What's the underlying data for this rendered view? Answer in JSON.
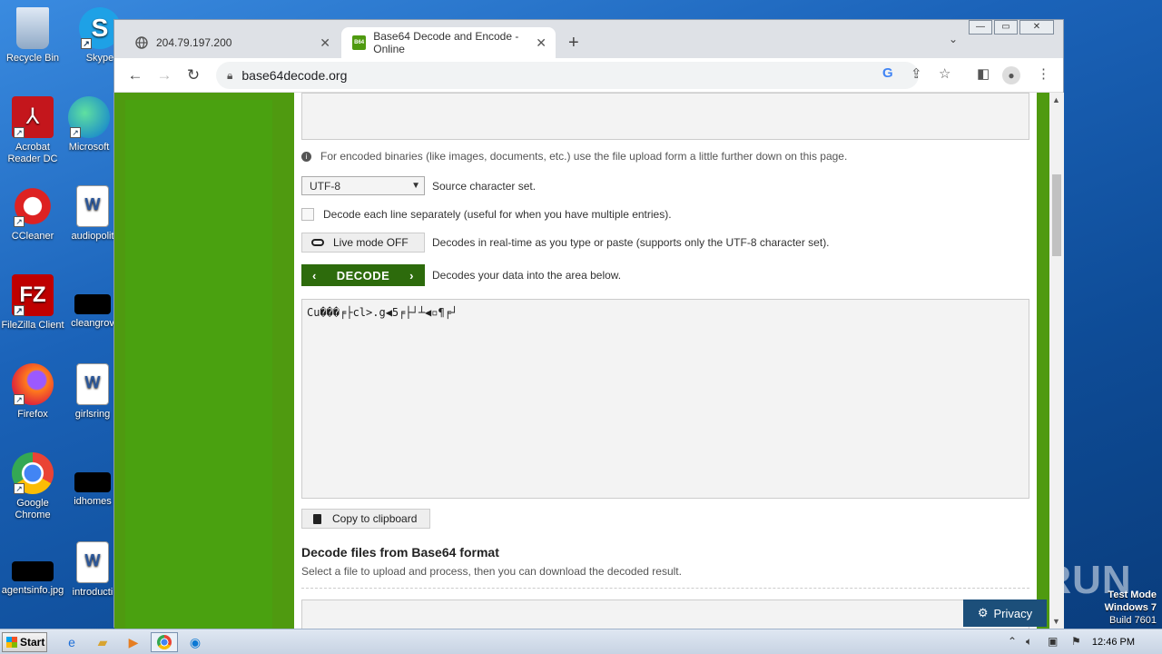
{
  "desktop": {
    "icons": [
      {
        "label": "Recycle Bin"
      },
      {
        "label": "Skype"
      },
      {
        "label": "Acrobat Reader DC"
      },
      {
        "label": "Microsoft"
      },
      {
        "label": "CCleaner"
      },
      {
        "label": "audiopolit"
      },
      {
        "label": "FileZilla Client"
      },
      {
        "label": "cleangrov"
      },
      {
        "label": "Firefox"
      },
      {
        "label": "girlsring"
      },
      {
        "label": "Google Chrome"
      },
      {
        "label": "idhomes"
      },
      {
        "label": "agentsinfo.jpg"
      },
      {
        "label": "introducti"
      }
    ]
  },
  "browser": {
    "tabs": [
      {
        "title": "204.79.197.200",
        "icon": "globe-icon"
      },
      {
        "title": "Base64 Decode and Encode - Online",
        "icon": "b64-favicon"
      }
    ],
    "favicon_text": "B64",
    "url": "base64decode.org"
  },
  "page": {
    "info_text": "For encoded binaries (like images, documents, etc.) use the file upload form a little further down on this page.",
    "charset": {
      "selected": "UTF-8",
      "label": "Source character set."
    },
    "decode_each_line": {
      "checked": false,
      "label": "Decode each line separately (useful for when you have multiple entries)."
    },
    "live_mode": {
      "button": "Live mode OFF",
      "desc": "Decodes in real-time as you type or paste (supports only the UTF-8 character set)."
    },
    "decode": {
      "button": "DECODE",
      "desc": "Decodes your data into the area below."
    },
    "output_text": "Cu���╒├cl>.g◀5╒├┘┴◀▫¶╒┘",
    "copy_button": "Copy to clipboard",
    "files_heading": "Decode files from Base64 format",
    "files_sub": "Select a file to upload and process, then you can download the decoded result.",
    "privacy_button": "Privacy"
  },
  "overlay": {
    "watermark": "ANY RUN",
    "test_mode": "Test Mode",
    "os": "Windows 7",
    "build": "Build 7601"
  },
  "taskbar": {
    "start": "Start",
    "clock": "12:46 PM"
  },
  "colors": {
    "accent_green": "#4f9a10",
    "decode_green": "#2d6b0c"
  }
}
